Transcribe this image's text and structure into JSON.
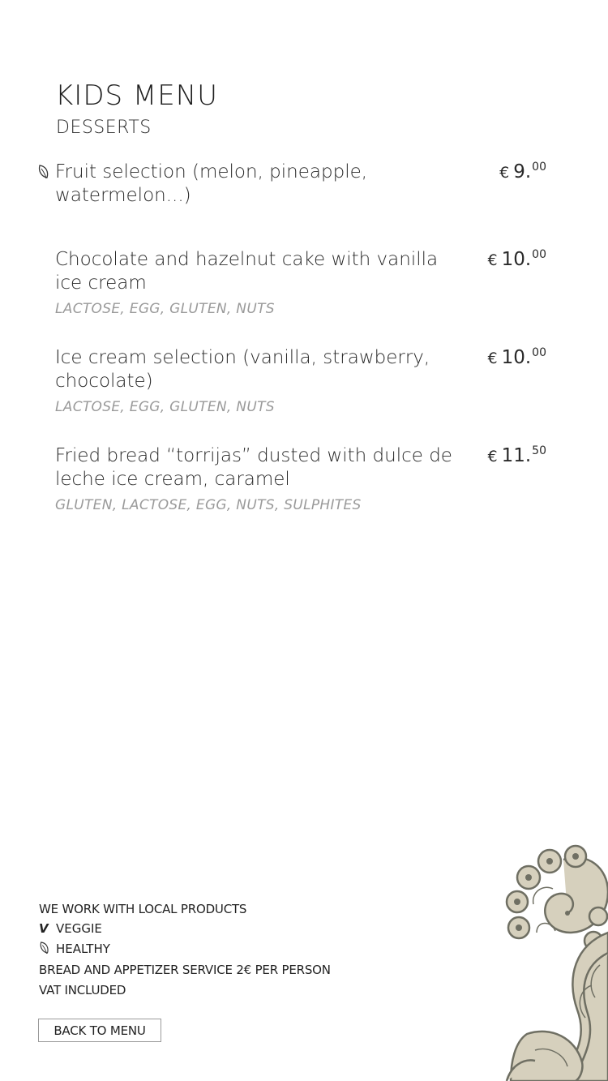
{
  "header": {
    "title": "KIDS MENU",
    "subtitle": "DESSERTS"
  },
  "items": [
    {
      "name": "Fruit selection (melon, pineapple, watermelon...)",
      "allergens": "",
      "price_currency": "€",
      "price_main": "9.",
      "price_cents": "00",
      "marker": "leaf-icon"
    },
    {
      "name": "Chocolate and hazelnut cake with vanilla ice cream",
      "allergens": "LACTOSE, EGG, GLUTEN, NUTS",
      "price_currency": "€",
      "price_main": "10.",
      "price_cents": "00"
    },
    {
      "name": "Ice cream selection (vanilla, strawberry, chocolate)",
      "allergens": "LACTOSE, EGG, GLUTEN, NUTS",
      "price_currency": "€",
      "price_main": "10.",
      "price_cents": "00"
    },
    {
      "name": "Fried bread “torrijas” dusted with dulce de leche ice cream, caramel",
      "allergens": "GLUTEN, LACTOSE, EGG, NUTS, SULPHITES",
      "price_currency": "€",
      "price_main": "11.",
      "price_cents": "50"
    }
  ],
  "footer": {
    "local": "WE WORK WITH LOCAL PRODUCTS",
    "veggie_mark": "V",
    "veggie_label": "VEGGIE",
    "healthy_label": "HEALTHY",
    "bread": "BREAD AND APPETIZER SERVICE 2€ PER PERSON",
    "vat": "VAT INCLUDED",
    "back_button": "BACK TO MENU"
  },
  "colors": {
    "text": "#222222",
    "allergen": "#9a9a9a",
    "ornament_fill": "#d6d0bd",
    "ornament_stroke": "#6f6f63"
  }
}
